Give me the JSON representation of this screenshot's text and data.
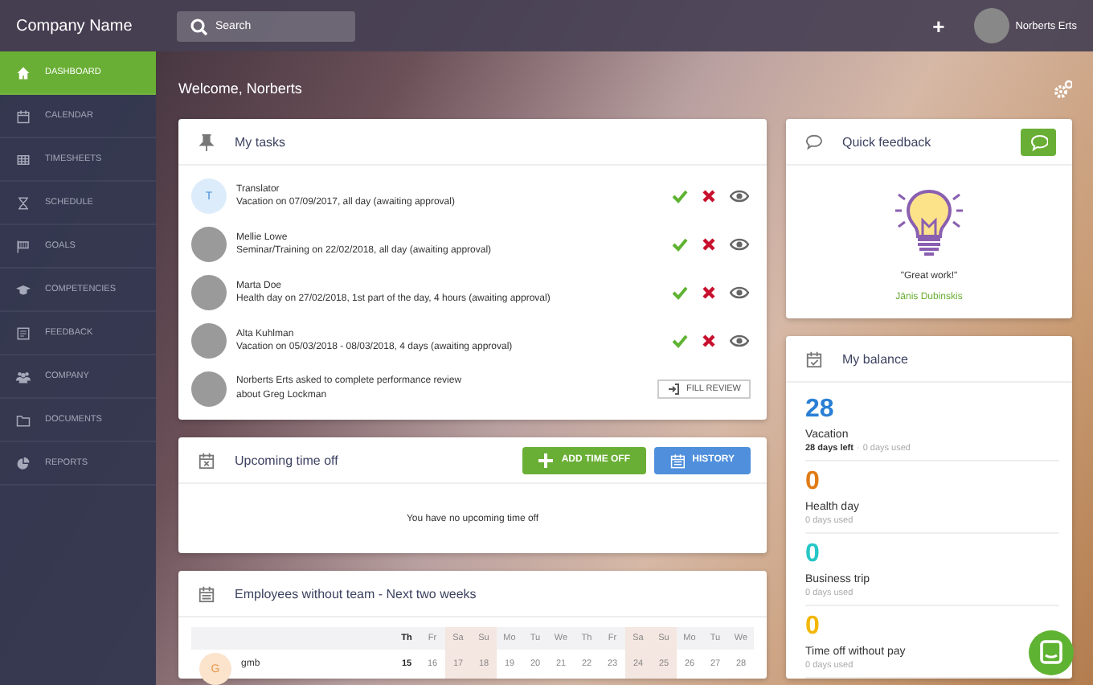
{
  "topbar": {
    "company": "Company Name",
    "search": {
      "placeholder": "Search"
    },
    "add": "+",
    "user": "Norberts Erts"
  },
  "sidebar": {
    "items": [
      {
        "label": "DASHBOARD",
        "selected": true
      },
      {
        "label": "CALENDAR",
        "selected": false
      },
      {
        "label": "TIMESHEETS",
        "selected": false
      },
      {
        "label": "SCHEDULE",
        "selected": false
      },
      {
        "label": "GOALS",
        "selected": false
      },
      {
        "label": "COMPETENCIES",
        "selected": false
      },
      {
        "label": "FEEDBACK",
        "selected": false
      },
      {
        "label": "COMPANY",
        "selected": false
      },
      {
        "label": "DOCUMENTS",
        "selected": false
      },
      {
        "label": "REPORTS",
        "selected": false
      }
    ]
  },
  "welcome": "Welcome, Norberts",
  "tasks": {
    "title": "My tasks",
    "items": [
      {
        "kind": "approval",
        "initial": "T",
        "name": "Translator",
        "detail": "Vacation on 07/09/2017, all day (awaiting approval)"
      },
      {
        "kind": "approval",
        "name": "Mellie Lowe",
        "detail": "Seminar/Training on 22/02/2018, all day (awaiting approval)"
      },
      {
        "kind": "approval",
        "name": "Marta Doe",
        "detail": "Health day on 27/02/2018, 1st part of the day, 4 hours (awaiting approval)"
      },
      {
        "kind": "approval",
        "name": "Alta Kuhlman",
        "detail": "Vacation on 05/03/2018 - 08/03/2018, 4 days (awaiting approval)"
      },
      {
        "kind": "review",
        "text": "Norberts Erts asked to complete performance review about Greg Lockman",
        "button": "FILL REVIEW"
      }
    ]
  },
  "upcoming": {
    "title": "Upcoming time off",
    "add_button": "ADD TIME OFF",
    "history_button": "HISTORY",
    "empty": "You have no upcoming time off"
  },
  "employees": {
    "title": "Employees without team - Next two weeks",
    "days": [
      {
        "day": "Th",
        "date": "15",
        "today": true,
        "weekend": false
      },
      {
        "day": "Fr",
        "date": "16",
        "today": false,
        "weekend": false
      },
      {
        "day": "Sa",
        "date": "17",
        "today": false,
        "weekend": true
      },
      {
        "day": "Su",
        "date": "18",
        "today": false,
        "weekend": true
      },
      {
        "day": "Mo",
        "date": "19",
        "today": false,
        "weekend": false
      },
      {
        "day": "Tu",
        "date": "20",
        "today": false,
        "weekend": false
      },
      {
        "day": "We",
        "date": "21",
        "today": false,
        "weekend": false
      },
      {
        "day": "Th",
        "date": "22",
        "today": false,
        "weekend": false
      },
      {
        "day": "Fr",
        "date": "23",
        "today": false,
        "weekend": false
      },
      {
        "day": "Sa",
        "date": "24",
        "today": false,
        "weekend": true
      },
      {
        "day": "Su",
        "date": "25",
        "today": false,
        "weekend": true
      },
      {
        "day": "Mo",
        "date": "26",
        "today": false,
        "weekend": false
      },
      {
        "day": "Tu",
        "date": "27",
        "today": false,
        "weekend": false
      },
      {
        "day": "We",
        "date": "28",
        "today": false,
        "weekend": false
      }
    ],
    "rows": [
      {
        "initial": "G",
        "name": "gmb"
      }
    ]
  },
  "feedback": {
    "title": "Quick feedback",
    "quote": "\"Great work!\"",
    "author": "Jānis Dubinskis"
  },
  "balance": {
    "title": "My balance",
    "items": [
      {
        "number": "28",
        "color": "#2a7fd4",
        "label": "Vacation",
        "left": "28 days left",
        "separator": "·",
        "used": "0 days used"
      },
      {
        "number": "0",
        "color": "#e07b16",
        "label": "Health day",
        "used": "0 days used"
      },
      {
        "number": "0",
        "color": "#26c6c6",
        "label": "Business trip",
        "used": "0 days used"
      },
      {
        "number": "0",
        "color": "#f2b705",
        "label": "Time off without pay",
        "used": "0 days used"
      }
    ]
  }
}
